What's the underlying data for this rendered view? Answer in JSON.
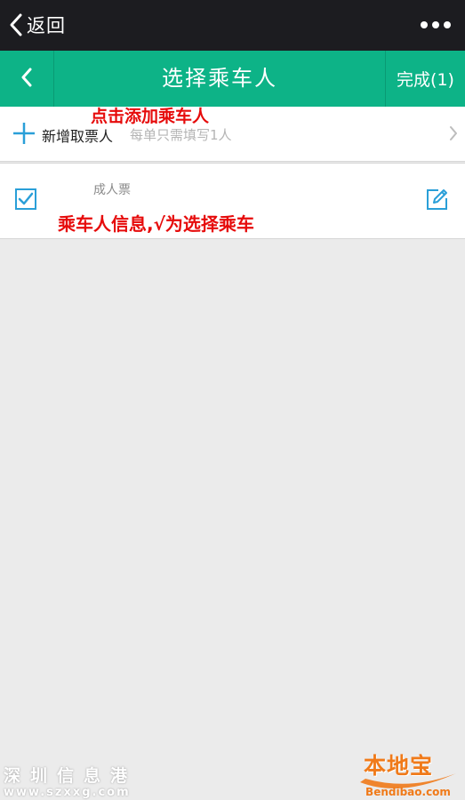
{
  "topbar": {
    "back_label": "返回",
    "more_icon": "more-dots-icon"
  },
  "header": {
    "title": "选择乘车人",
    "done_label": "完成(1)",
    "background": "#0db387"
  },
  "add_passenger": {
    "label": "新增取票人",
    "hint": "每单只需填写1人"
  },
  "passenger": {
    "ticket_type": "成人票",
    "selected": true
  },
  "annotations": {
    "add": "点击添加乘车人",
    "info": "乘车人信息,√为选择乘车"
  },
  "watermarks": {
    "left_title": "深圳信息港",
    "left_url": "www.szxxg.com",
    "right_logo": "本地宝",
    "right_site": "Bendibao.com"
  },
  "colors": {
    "accent": "#0db387",
    "icon_blue": "#2a9fd8",
    "annotation": "#e60b0b",
    "top_bar": "#1c1c20"
  }
}
